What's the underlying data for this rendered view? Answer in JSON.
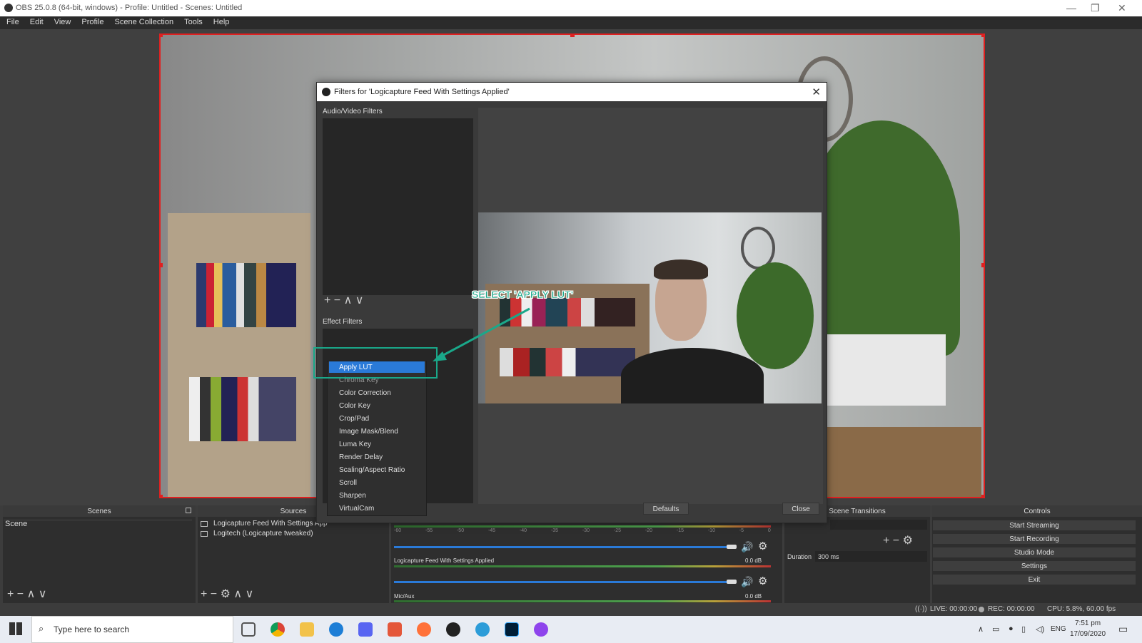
{
  "window": {
    "title": "OBS 25.0.8 (64-bit, windows) - Profile: Untitled - Scenes: Untitled",
    "minimize": "—",
    "restore": "❐",
    "close": "✕"
  },
  "menu": [
    "File",
    "Edit",
    "View",
    "Profile",
    "Scene Collection",
    "Tools",
    "Help"
  ],
  "dialog": {
    "title": "Filters for 'Logicapture Feed With Settings Applied'",
    "close": "✕",
    "av_label": "Audio/Video Filters",
    "effect_label": "Effect Filters",
    "toolbar": [
      "+",
      "−",
      "∧",
      "∨"
    ],
    "defaults_label": "Defaults",
    "close_label": "Close"
  },
  "context_menu": {
    "items": [
      "Apply LUT",
      "Chroma Key",
      "Color Correction",
      "Color Key",
      "Crop/Pad",
      "Image Mask/Blend",
      "Luma Key",
      "Render Delay",
      "Scaling/Aspect Ratio",
      "Scroll",
      "Sharpen",
      "VirtualCam"
    ],
    "selected_index": 0
  },
  "annotation": {
    "callout": "SELECT 'APPLY LUT'"
  },
  "docks": {
    "scenes": {
      "header": "Scenes",
      "items": [
        "Scene"
      ]
    },
    "sources": {
      "header": "Sources",
      "items": [
        "Logicapture Feed With Settings App",
        "Logitech (Logicapture tweaked)"
      ]
    },
    "mixer": {
      "tracks": [
        {
          "name": "Logicapture Feed With Settings Applied",
          "db": "0.0 dB"
        },
        {
          "name": "Mic/Aux",
          "db": "0.0 dB"
        }
      ],
      "first_db": "0.0 dB",
      "ticks": [
        "-60",
        "-55",
        "-50",
        "-45",
        "-40",
        "-35",
        "-30",
        "-25",
        "-20",
        "-15",
        "-10",
        "-5",
        "0"
      ]
    },
    "transitions": {
      "header": "Scene Transitions",
      "duration_label": "Duration",
      "duration_value": "300 ms"
    },
    "controls": {
      "header": "Controls",
      "buttons": [
        "Start Streaming",
        "Start Recording",
        "Studio Mode",
        "Settings",
        "Exit"
      ]
    }
  },
  "status": {
    "live": "LIVE: 00:00:00",
    "rec": "REC: 00:00:00",
    "cpu": "CPU: 5.8%, 60.00 fps"
  },
  "taskbar": {
    "search_placeholder": "Type here to search",
    "lang": "ENG",
    "time": "7:51 pm",
    "date": "17/09/2020"
  },
  "colors": {
    "accent": "#2a7ad8",
    "highlight": "#1aa88a",
    "selection_border": "#e02020"
  }
}
